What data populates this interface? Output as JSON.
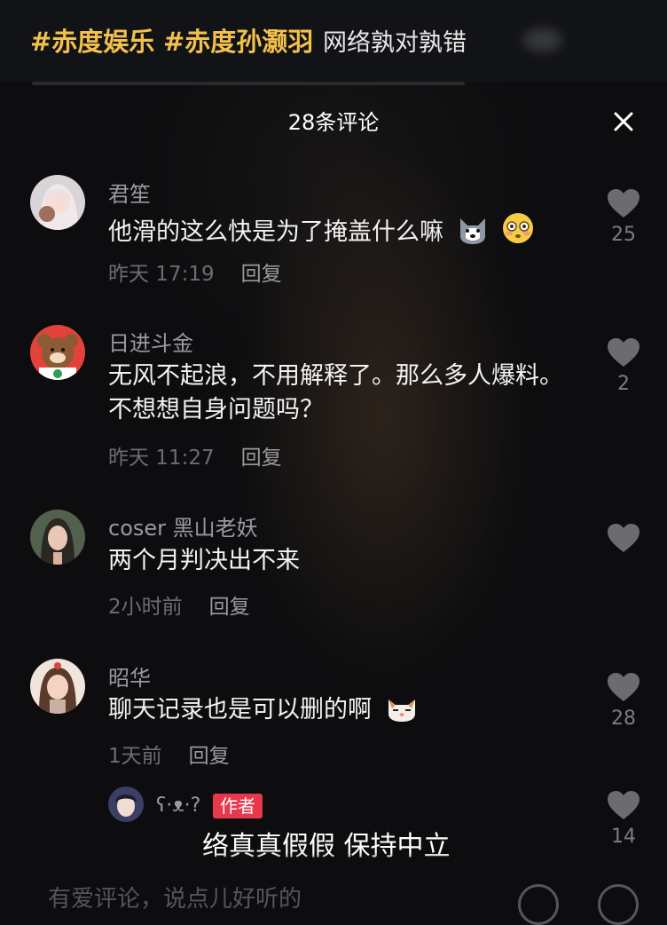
{
  "header": {
    "topic1": "#赤度娱乐",
    "topic2": "#赤度孙灏羽",
    "title_text": "网络孰对孰错"
  },
  "sheet": {
    "title": "28条评论",
    "close_icon": "close-icon"
  },
  "comments": [
    {
      "username": "君笙",
      "text": "他滑的这么快是为了掩盖什么嘛",
      "emojis": [
        "husky-emoji",
        "flushed-face-emoji"
      ],
      "time": "昨天 17:19",
      "reply": "回复",
      "likes": "25"
    },
    {
      "username": "日进斗金",
      "text": "无风不起浪，不用解释了。那么多人爆料。不想想自身问题吗？",
      "time": "昨天 11:27",
      "reply": "回复",
      "likes": "2"
    },
    {
      "username": "coser 黑山老妖",
      "text": "两个月判决出不来",
      "time": "2小时前",
      "reply": "回复",
      "likes": ""
    },
    {
      "username": "昭华",
      "text": "聊天记录也是可以删的啊",
      "emojis": [
        "cat-emoji"
      ],
      "time": "1天前",
      "reply": "回复",
      "likes": "28"
    },
    {
      "username": "ʕ·ᴥ·?",
      "badge": "作者",
      "likes": "14"
    }
  ],
  "overlay_caption": "络真真假假 保持中立",
  "input": {
    "placeholder": "有爱评论，说点儿好听的"
  },
  "colors": {
    "topic": "#f2c14b",
    "author_badge": "#e8384d",
    "background": "#0d0d0f"
  }
}
